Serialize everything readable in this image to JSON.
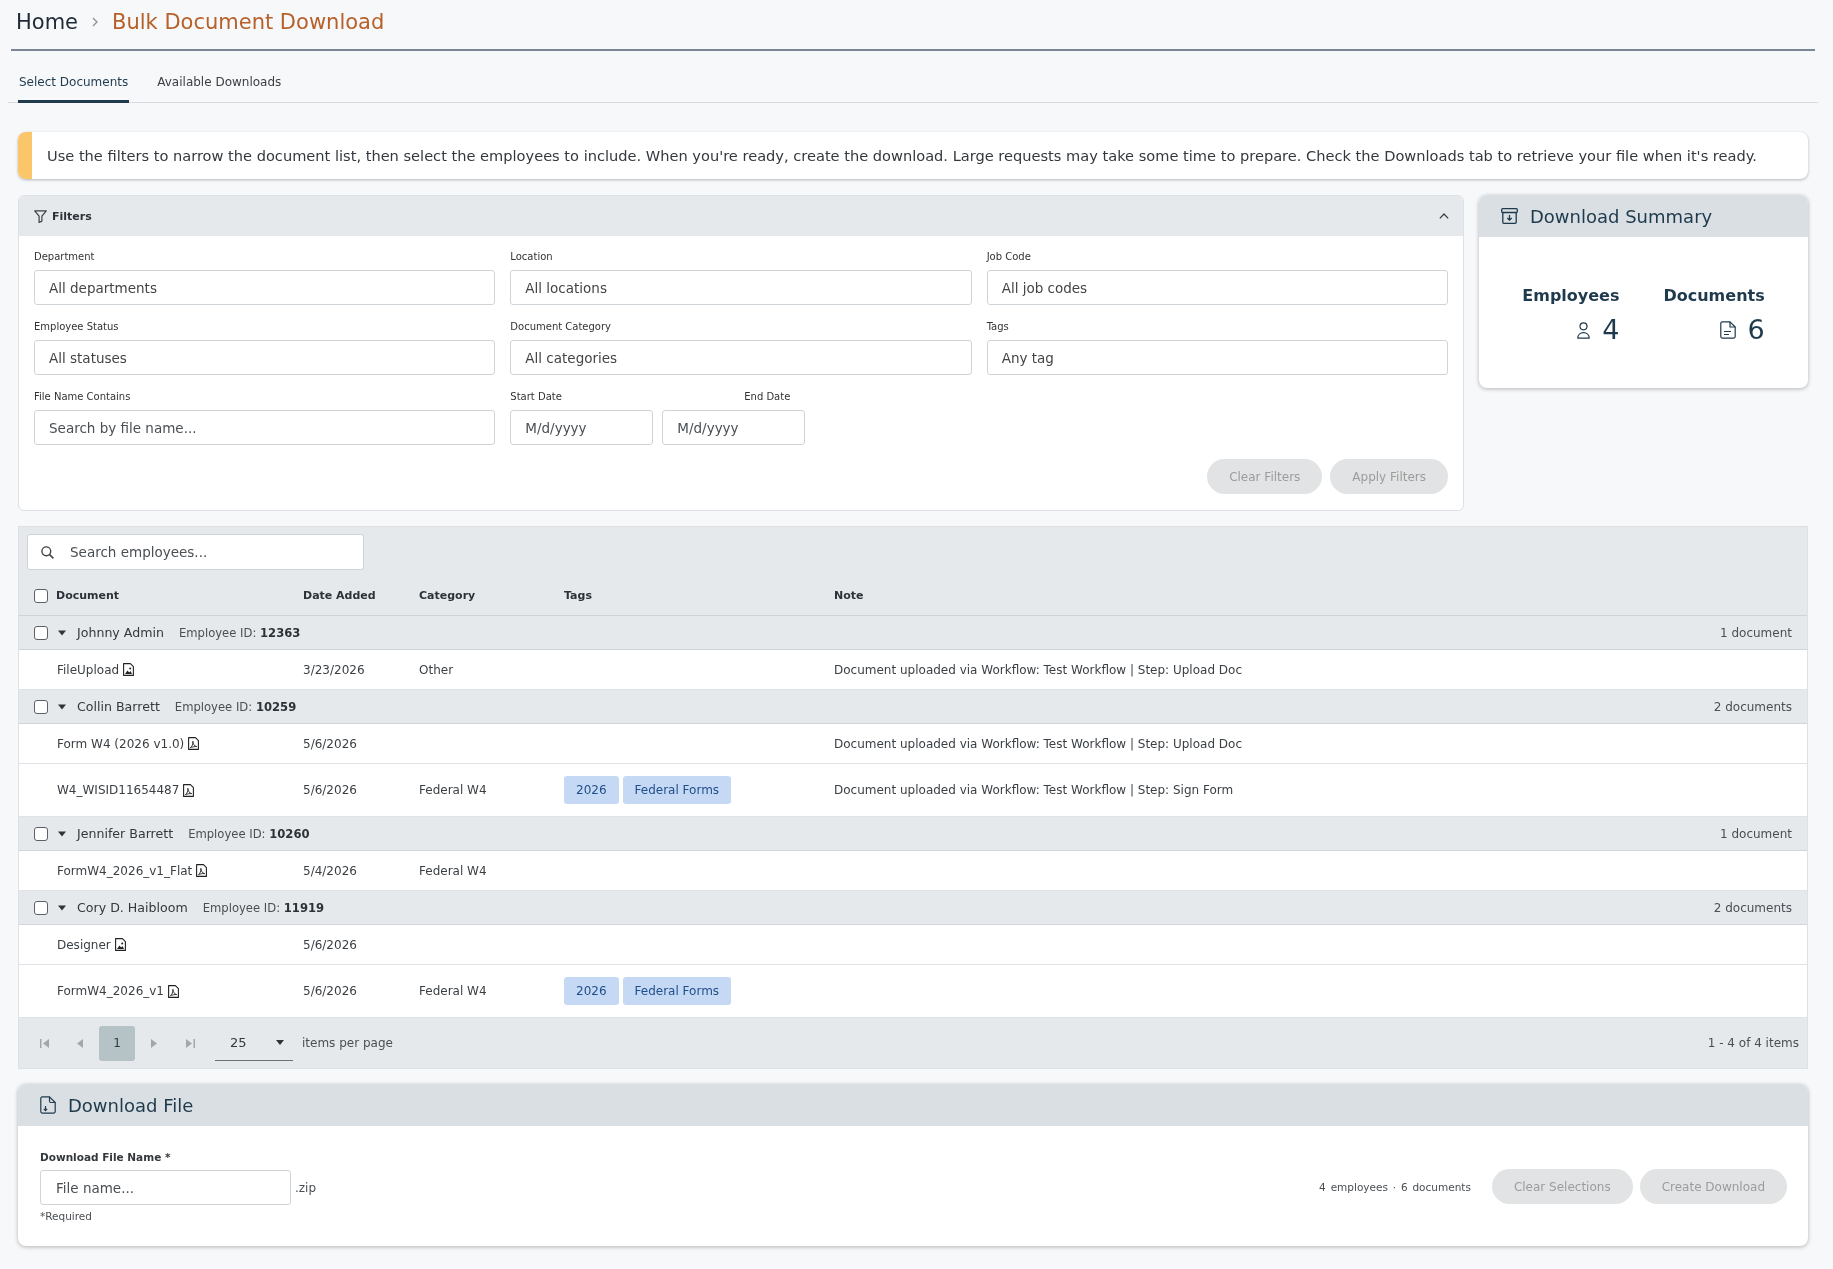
{
  "breadcrumb": [
    {
      "label": "Home",
      "current": false
    },
    {
      "label": "Bulk Document Download",
      "current": true
    }
  ],
  "tabs": [
    {
      "label": "Select Documents",
      "selected": true
    },
    {
      "label": "Available Downloads",
      "selected": false
    }
  ],
  "notice": {
    "text": "Use the filters to narrow the document list, then select the employees to include. When you're ready, create the download. Large requests may take some time to prepare. Check the Downloads tab to retrieve your file when it's ready."
  },
  "filters": {
    "title": "Filters",
    "expanded": true,
    "fields": [
      {
        "kind": "select",
        "label": "Department",
        "value": "All departments"
      },
      {
        "kind": "select",
        "label": "Location",
        "value": "All locations"
      },
      {
        "kind": "select",
        "label": "Job Code",
        "value": "All job codes"
      },
      {
        "kind": "select",
        "label": "Employee Status",
        "value": "All statuses"
      },
      {
        "kind": "select",
        "label": "Document Category",
        "value": "All categories"
      },
      {
        "kind": "select",
        "label": "Tags",
        "value": "Any tag"
      },
      {
        "kind": "text",
        "label": "File Name Contains",
        "placeholder": "Search by file name..."
      }
    ],
    "date_range": [
      {
        "label": "Start Date",
        "placeholder": "M/d/yyyy"
      },
      {
        "label": "End Date",
        "placeholder": "M/d/yyyy"
      }
    ],
    "buttons": [
      {
        "label": "Clear Filters",
        "disabled": true
      },
      {
        "label": "Apply Filters",
        "disabled": true
      }
    ]
  },
  "summary": {
    "title": "Download Summary",
    "stats": [
      {
        "kind": "employees",
        "label": "Employees",
        "value": "4"
      },
      {
        "kind": "documents",
        "label": "Documents",
        "value": "6"
      }
    ]
  },
  "table": {
    "search": {
      "placeholder": "Search employees..."
    },
    "select_all": {
      "checked": false
    },
    "columns": [
      "Document",
      "Date Added",
      "Category",
      "Tags",
      "Note"
    ],
    "groups": [
      {
        "name": "Johnny Admin",
        "employee_id": "Employee ID: **12363**",
        "count": "1 document",
        "checked": false,
        "expanded": true,
        "documents": [
          {
            "kind": "image",
            "name": "FileUpload",
            "date": "3/23/2026",
            "category": "Other",
            "note": "Document uploaded via Workflow: Test Workflow | Step: Upload Doc"
          }
        ]
      },
      {
        "name": "Collin Barrett",
        "employee_id": "Employee ID: **10259**",
        "count": "2 documents",
        "checked": false,
        "expanded": true,
        "documents": [
          {
            "kind": "pdf",
            "name": "Form W4 (2026 v1.0)",
            "date": "5/6/2026",
            "note": "Document uploaded via Workflow: Test Workflow | Step: Upload Doc"
          },
          {
            "kind": "pdf",
            "name": "W4_WISID11654487",
            "date": "5/6/2026",
            "category": "Federal W4",
            "tags": [
              "2026",
              "Federal Forms"
            ],
            "note": "Document uploaded via Workflow: Test Workflow | Step: Sign Form"
          }
        ]
      },
      {
        "name": "Jennifer Barrett",
        "employee_id": "Employee ID: **10260**",
        "count": "1 document",
        "checked": false,
        "expanded": true,
        "documents": [
          {
            "kind": "pdf",
            "name": "FormW4_2026_v1_Flat",
            "date": "5/4/2026",
            "category": "Federal W4"
          }
        ]
      },
      {
        "name": "Cory D. Haibloom",
        "employee_id": "Employee ID: **11919**",
        "count": "2 documents",
        "checked": false,
        "expanded": true,
        "documents": [
          {
            "kind": "image",
            "name": "Designer",
            "date": "5/6/2026"
          },
          {
            "kind": "pdf",
            "name": "FormW4_2026_v1",
            "date": "5/6/2026",
            "category": "Federal W4",
            "tags": [
              "2026",
              "Federal Forms"
            ]
          }
        ]
      }
    ]
  },
  "pager": {
    "pages": [
      {
        "label": "1",
        "selected": true
      }
    ],
    "page_size": "25",
    "page_size_label": "items per page",
    "range": "1 - 4 of 4 items"
  },
  "download": {
    "title": "Download File",
    "field": {
      "label": "Download File Name *",
      "placeholder": "File name...",
      "suffix": ".zip",
      "hint": "*Required"
    },
    "selection": "4 employees · 6 documents",
    "buttons": [
      {
        "label": "Clear Selections",
        "disabled": true
      },
      {
        "label": "Create Download",
        "disabled": true
      }
    ]
  }
}
